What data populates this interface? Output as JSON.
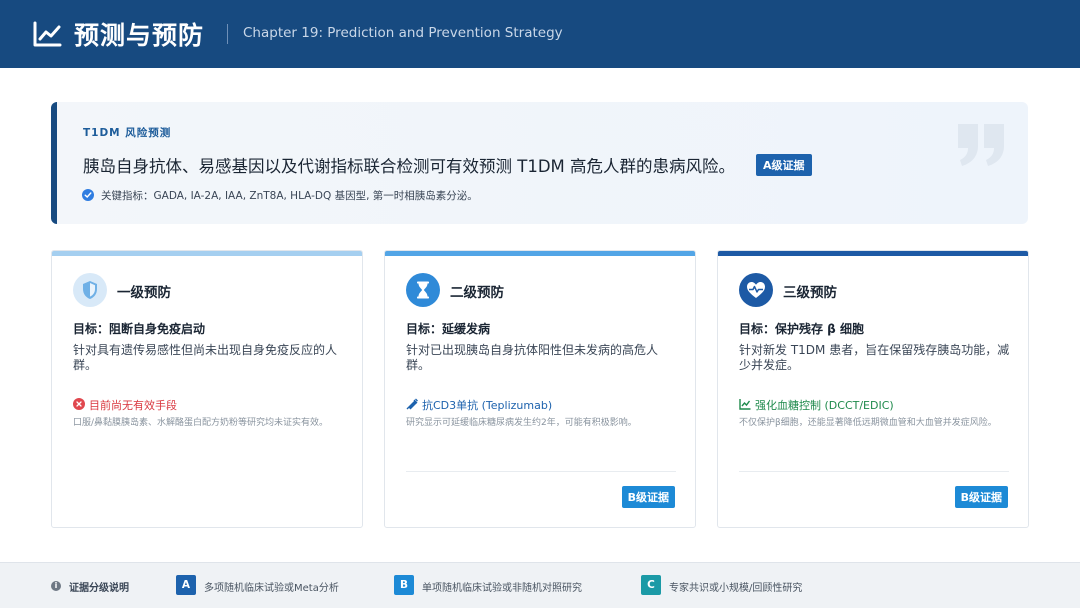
{
  "header": {
    "title": "预测与预防",
    "subtitle": "Chapter 19: Prediction and Prevention Strategy",
    "icon": "line-chart-icon"
  },
  "quote": {
    "tag": "T1DM 风险预测",
    "main": "胰岛自身抗体、易感基因以及代谢指标联合检测可有效预测 T1DM 高危人群的患病风险。",
    "badge": "A级证据",
    "keys": "关键指标：GADA, IA-2A, IAA, ZnT8A, HLA-DQ 基因型, 第一时相胰岛素分泌。"
  },
  "cards": [
    {
      "title": "一级预防",
      "icon": "shield-icon",
      "goal": "目标：阻断自身免疫启动",
      "desc": "针对具有遗传易感性但尚未出现自身免疫反应的人群。",
      "note_title": "目前尚无有效手段",
      "note_icon": "x-circle-icon",
      "note_color": "#d9363e",
      "note": "口服/鼻黏膜胰岛素、水解酪蛋白配方奶粉等研究均未证实有效。",
      "badge": ""
    },
    {
      "title": "二级预防",
      "icon": "hourglass-icon",
      "goal": "目标：延缓发病",
      "desc": "针对已出现胰岛自身抗体阳性但未发病的高危人群。",
      "note_title": "抗CD3单抗 (Teplizumab)",
      "note_icon": "syringe-icon",
      "note_color": "#1d62ad",
      "note": "研究显示可延缓临床糖尿病发生约2年，可能有积极影响。",
      "badge": "B级证据"
    },
    {
      "title": "三级预防",
      "icon": "heart-pulse-icon",
      "goal": "目标：保护残存 β 细胞",
      "desc": "针对新发 T1DM 患者，旨在保留残存胰岛功能，减少并发症。",
      "note_title": "强化血糖控制 (DCCT/EDIC)",
      "note_icon": "line-chart-icon",
      "note_color": "#1f8a4c",
      "note": "不仅保护β细胞，还能显著降低远期微血管和大血管并发症风险。",
      "badge": "B级证据"
    }
  ],
  "footer": {
    "title": "证据分级说明",
    "levels": [
      {
        "letter": "A",
        "text": "多项随机临床试验或Meta分析",
        "color": "#1d62ad"
      },
      {
        "letter": "B",
        "text": "单项随机临床试验或非随机对照研究",
        "color": "#1d8ad6"
      },
      {
        "letter": "C",
        "text": "专家共识或小规模/回顾性研究",
        "color": "#1b9aa6"
      }
    ]
  }
}
